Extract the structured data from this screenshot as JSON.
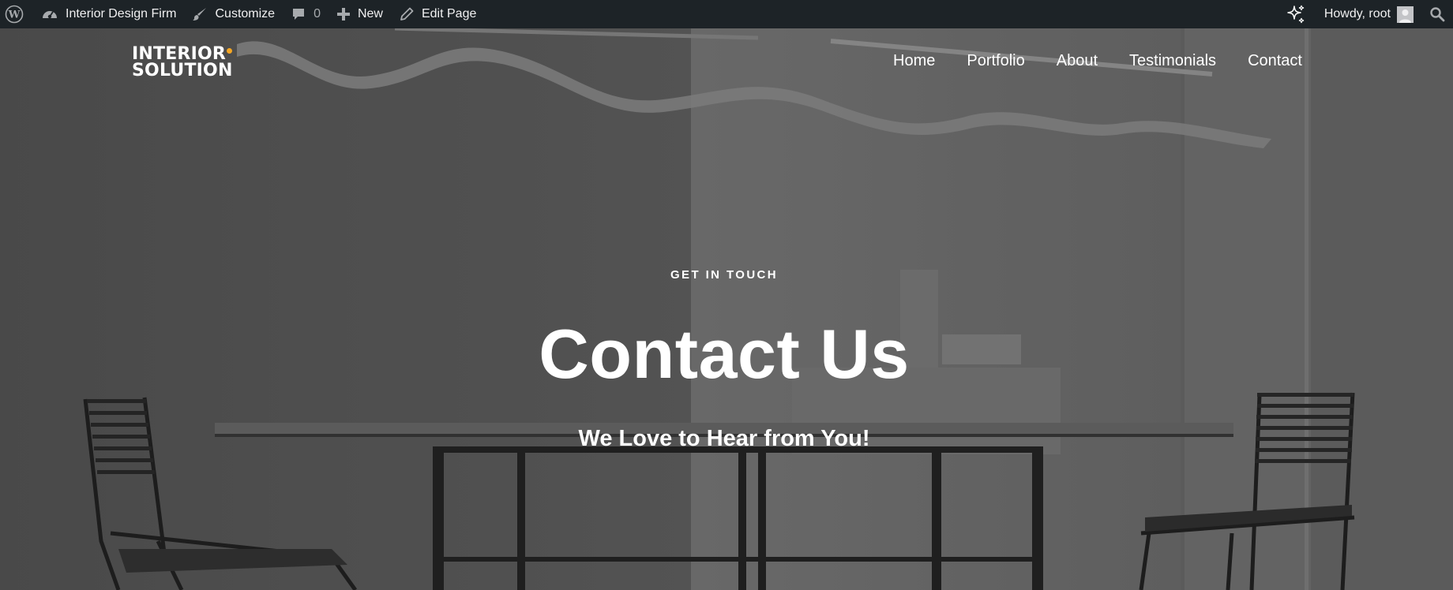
{
  "adminbar": {
    "wp_logo_icon": "wordpress-logo-icon",
    "site_name": "Interior Design Firm",
    "customize": "Customize",
    "comments_count": "0",
    "new": "New",
    "edit_page": "Edit Page",
    "howdy": "Howdy, root",
    "background": "#1d2327"
  },
  "site": {
    "logo_line1": "INTERIOR",
    "logo_line2": "SOLUTION",
    "logo_dot_color": "#f5a623",
    "nav": [
      "Home",
      "Portfolio",
      "About",
      "Testimonials",
      "Contact"
    ]
  },
  "hero": {
    "eyebrow": "GET IN TOUCH",
    "title": "Contact Us",
    "subtitle": "We Love to Hear from You!"
  }
}
